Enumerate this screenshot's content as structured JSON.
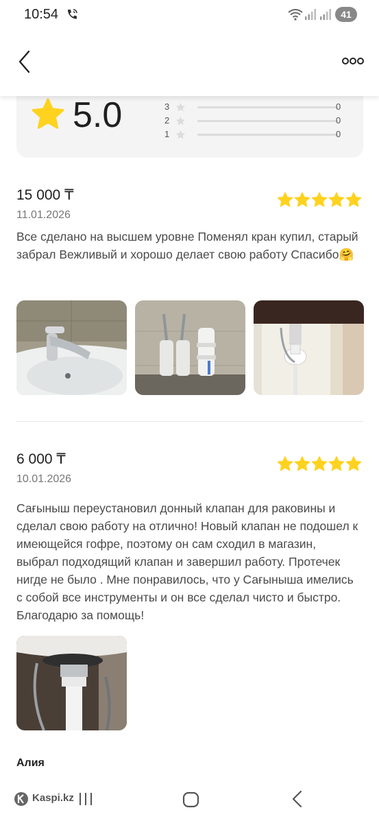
{
  "status_bar": {
    "time": "10:54",
    "battery": "41"
  },
  "rating_summary": {
    "average": "5.0",
    "distribution": [
      {
        "stars": "3",
        "count": "0"
      },
      {
        "stars": "2",
        "count": "0"
      },
      {
        "stars": "1",
        "count": "0"
      }
    ]
  },
  "reviews": [
    {
      "price": "15 000 ₸",
      "date": "11.01.2026",
      "rating": 5,
      "text": "Все сделано на высшем уровне Поменял кран купил, старый забрал Вежливый и хорошо делает свою работу Спасибо🤗"
    },
    {
      "price": "6 000 ₸",
      "date": "10.01.2026",
      "rating": 5,
      "text": "Сағыныш переустановил донный клапан для раковины и сделал свою работу на отлично! Новый клапан не подошел к имеющейся гофре, поэтому он сам сходил в магазин, выбрал подходящий клапан и завершил работу. Протечек нигде не было . Мне понравилось, что у Сағыныша имелись с собой все инструменты и он все сделал чисто и быстро. Благодарю за помощь!"
    }
  ],
  "next_review": {
    "author": "Алия"
  },
  "nav": {
    "brand": "Kaspi.kz"
  },
  "colors": {
    "star": "#ffd21f",
    "accent": "#f14635"
  }
}
